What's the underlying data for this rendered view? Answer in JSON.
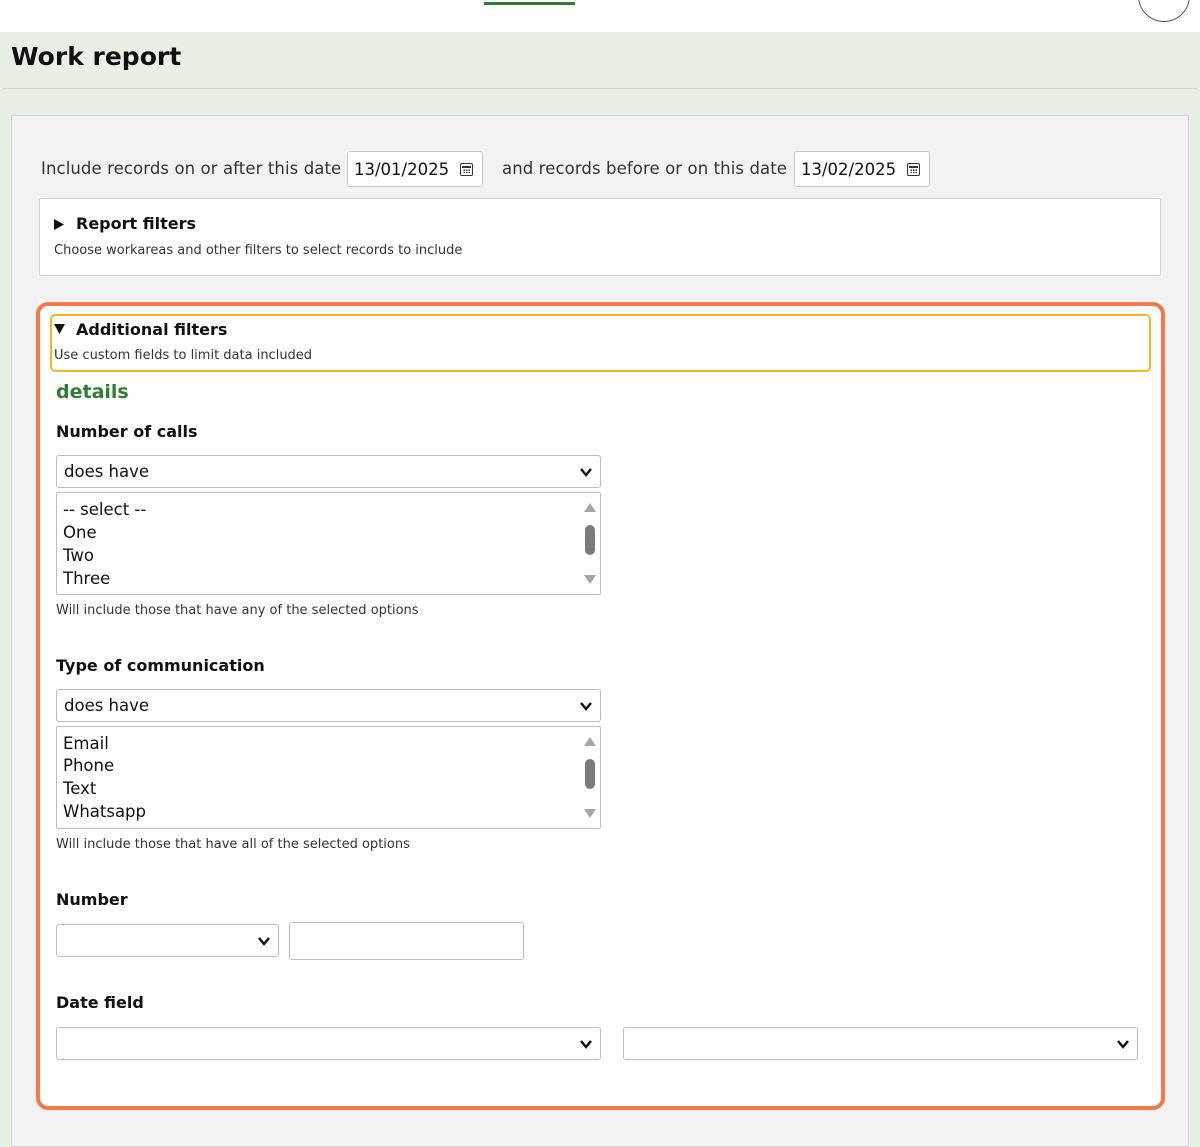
{
  "page": {
    "title": "Work report"
  },
  "dates": {
    "after_label": "Include records on or after this date",
    "after_value": "13/01/2025",
    "before_label": "and records before or on this date",
    "before_value": "13/02/2025"
  },
  "report_filters": {
    "title": "Report filters",
    "description": "Choose workareas and other filters to select records to include",
    "expanded": false
  },
  "additional_filters": {
    "title": "Additional filters",
    "description": "Use custom fields to limit data included",
    "expanded": true,
    "section_heading": "details",
    "fields": {
      "number_of_calls": {
        "label": "Number of calls",
        "mode": "does have",
        "options": [
          "-- select --",
          "One",
          "Two",
          "Three"
        ],
        "hint": "Will include those that have any of the selected options"
      },
      "type_of_communication": {
        "label": "Type of communication",
        "mode": "does have",
        "options": [
          "Email",
          "Phone",
          "Text",
          "Whatsapp"
        ],
        "hint": "Will include those that have all of the selected options"
      },
      "number": {
        "label": "Number",
        "operator": "",
        "value": ""
      },
      "date_field": {
        "label": "Date field",
        "first": "",
        "second": ""
      }
    }
  },
  "colors": {
    "brand_green": "#2e7d32",
    "highlight_orange": "#f5784a",
    "highlight_yellow": "#f4b623"
  },
  "icons": {
    "date_picker": "calendar-icon",
    "select": "chevron-down-icon",
    "disclosure_closed": "triangle-right-icon",
    "disclosure_open": "triangle-down-icon"
  }
}
